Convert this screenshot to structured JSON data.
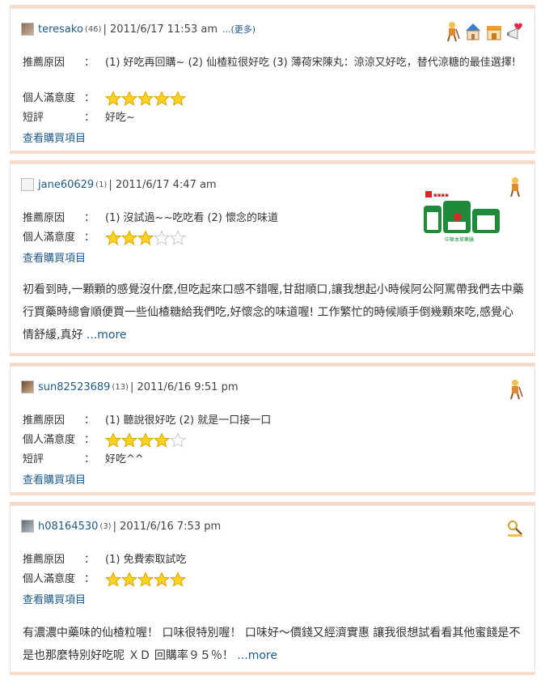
{
  "reviews": [
    {
      "user": "teresako",
      "count": "(46)",
      "date": "| 2011/6/17  11:53 am",
      "more_small": "...(更多)",
      "badges": [
        "walker-icon",
        "house-icon",
        "shop-icon",
        "megaphone-icon"
      ],
      "reason_label": "推薦原因",
      "reason": "(1) 好吃再回購~  (2) 仙楂粒很好吃  (3) 薄荷宋陳丸：涼涼又好吃，替代涼糖的最佳選擇!",
      "rating_label": "個人滿意度",
      "rating": 5,
      "short_label": "短評",
      "short": "好吃~",
      "link": "查看購買項目"
    },
    {
      "user": "jane60629",
      "count": "(1)",
      "date": "| 2011/6/17  4:47 am",
      "badges": [
        "walker-icon"
      ],
      "reason_label": "推薦原因",
      "reason": "(1) 沒試過~~吃吃看  (2) 懷念的味道",
      "rating_label": "個人滿意度",
      "rating": 3,
      "link": "查看購買項目",
      "body": "初看到時,一顆顆的感覺沒什麼,但吃起來口感不錯喔,甘甜順口,讓我想起小時候阿公阿罵帶我們去中藥行買藥時總會順便買一些仙楂糖給我們吃,好懷念的味道喔! 工作繁忙的時候順手倒幾顆來吃,感覺心情舒緩,真好",
      "more": "...more",
      "logo_small": "中華本草藥膳"
    },
    {
      "user": "sun82523689",
      "count": "(13)",
      "date": "| 2011/6/16  9:51 pm",
      "badges": [
        "walker-icon"
      ],
      "reason_label": "推薦原因",
      "reason": "(1) 聽說很好吃  (2) 就是一口接一口",
      "rating_label": "個人滿意度",
      "rating": 4,
      "short_label": "短評",
      "short": "好吃^^",
      "link": "查看購買項目"
    },
    {
      "user": "h08164530",
      "count": "(3)",
      "date": "| 2011/6/16  7:53 pm",
      "badges": [
        "search-person-icon"
      ],
      "reason_label": "推薦原因",
      "reason": "(1) 免費索取試吃",
      "rating_label": "個人滿意度",
      "rating": 5,
      "link": "查看購買項目",
      "body": "有濃濃中藥味的仙楂粒喔！ 口味很特別喔！  口味好～價錢又經濟實惠  讓我很想試看看其他蜜餞是不是也那麼特別好吃呢   ＸＤ   回購率９５％！",
      "more": "...more"
    }
  ],
  "colon": "："
}
